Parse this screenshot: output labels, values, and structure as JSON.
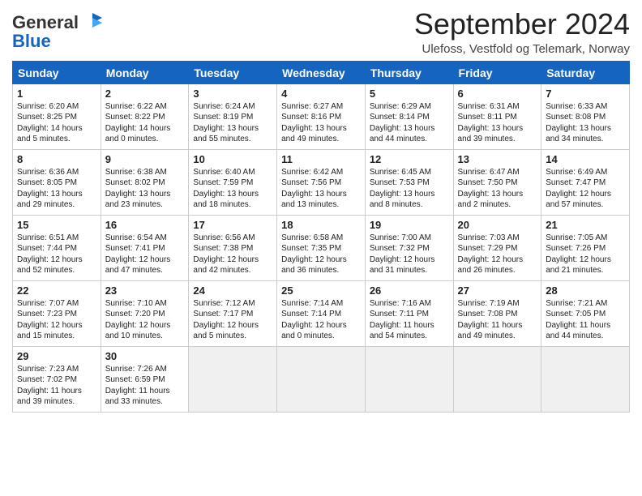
{
  "header": {
    "logo_general": "General",
    "logo_blue": "Blue",
    "month_title": "September 2024",
    "location": "Ulefoss, Vestfold og Telemark, Norway"
  },
  "weekdays": [
    "Sunday",
    "Monday",
    "Tuesday",
    "Wednesday",
    "Thursday",
    "Friday",
    "Saturday"
  ],
  "weeks": [
    [
      {
        "day": 1,
        "info": "Sunrise: 6:20 AM\nSunset: 8:25 PM\nDaylight: 14 hours and 5 minutes."
      },
      {
        "day": 2,
        "info": "Sunrise: 6:22 AM\nSunset: 8:22 PM\nDaylight: 14 hours and 0 minutes."
      },
      {
        "day": 3,
        "info": "Sunrise: 6:24 AM\nSunset: 8:19 PM\nDaylight: 13 hours and 55 minutes."
      },
      {
        "day": 4,
        "info": "Sunrise: 6:27 AM\nSunset: 8:16 PM\nDaylight: 13 hours and 49 minutes."
      },
      {
        "day": 5,
        "info": "Sunrise: 6:29 AM\nSunset: 8:14 PM\nDaylight: 13 hours and 44 minutes."
      },
      {
        "day": 6,
        "info": "Sunrise: 6:31 AM\nSunset: 8:11 PM\nDaylight: 13 hours and 39 minutes."
      },
      {
        "day": 7,
        "info": "Sunrise: 6:33 AM\nSunset: 8:08 PM\nDaylight: 13 hours and 34 minutes."
      }
    ],
    [
      {
        "day": 8,
        "info": "Sunrise: 6:36 AM\nSunset: 8:05 PM\nDaylight: 13 hours and 29 minutes."
      },
      {
        "day": 9,
        "info": "Sunrise: 6:38 AM\nSunset: 8:02 PM\nDaylight: 13 hours and 23 minutes."
      },
      {
        "day": 10,
        "info": "Sunrise: 6:40 AM\nSunset: 7:59 PM\nDaylight: 13 hours and 18 minutes."
      },
      {
        "day": 11,
        "info": "Sunrise: 6:42 AM\nSunset: 7:56 PM\nDaylight: 13 hours and 13 minutes."
      },
      {
        "day": 12,
        "info": "Sunrise: 6:45 AM\nSunset: 7:53 PM\nDaylight: 13 hours and 8 minutes."
      },
      {
        "day": 13,
        "info": "Sunrise: 6:47 AM\nSunset: 7:50 PM\nDaylight: 13 hours and 2 minutes."
      },
      {
        "day": 14,
        "info": "Sunrise: 6:49 AM\nSunset: 7:47 PM\nDaylight: 12 hours and 57 minutes."
      }
    ],
    [
      {
        "day": 15,
        "info": "Sunrise: 6:51 AM\nSunset: 7:44 PM\nDaylight: 12 hours and 52 minutes."
      },
      {
        "day": 16,
        "info": "Sunrise: 6:54 AM\nSunset: 7:41 PM\nDaylight: 12 hours and 47 minutes."
      },
      {
        "day": 17,
        "info": "Sunrise: 6:56 AM\nSunset: 7:38 PM\nDaylight: 12 hours and 42 minutes."
      },
      {
        "day": 18,
        "info": "Sunrise: 6:58 AM\nSunset: 7:35 PM\nDaylight: 12 hours and 36 minutes."
      },
      {
        "day": 19,
        "info": "Sunrise: 7:00 AM\nSunset: 7:32 PM\nDaylight: 12 hours and 31 minutes."
      },
      {
        "day": 20,
        "info": "Sunrise: 7:03 AM\nSunset: 7:29 PM\nDaylight: 12 hours and 26 minutes."
      },
      {
        "day": 21,
        "info": "Sunrise: 7:05 AM\nSunset: 7:26 PM\nDaylight: 12 hours and 21 minutes."
      }
    ],
    [
      {
        "day": 22,
        "info": "Sunrise: 7:07 AM\nSunset: 7:23 PM\nDaylight: 12 hours and 15 minutes."
      },
      {
        "day": 23,
        "info": "Sunrise: 7:10 AM\nSunset: 7:20 PM\nDaylight: 12 hours and 10 minutes."
      },
      {
        "day": 24,
        "info": "Sunrise: 7:12 AM\nSunset: 7:17 PM\nDaylight: 12 hours and 5 minutes."
      },
      {
        "day": 25,
        "info": "Sunrise: 7:14 AM\nSunset: 7:14 PM\nDaylight: 12 hours and 0 minutes."
      },
      {
        "day": 26,
        "info": "Sunrise: 7:16 AM\nSunset: 7:11 PM\nDaylight: 11 hours and 54 minutes."
      },
      {
        "day": 27,
        "info": "Sunrise: 7:19 AM\nSunset: 7:08 PM\nDaylight: 11 hours and 49 minutes."
      },
      {
        "day": 28,
        "info": "Sunrise: 7:21 AM\nSunset: 7:05 PM\nDaylight: 11 hours and 44 minutes."
      }
    ],
    [
      {
        "day": 29,
        "info": "Sunrise: 7:23 AM\nSunset: 7:02 PM\nDaylight: 11 hours and 39 minutes."
      },
      {
        "day": 30,
        "info": "Sunrise: 7:26 AM\nSunset: 6:59 PM\nDaylight: 11 hours and 33 minutes."
      },
      null,
      null,
      null,
      null,
      null
    ]
  ]
}
